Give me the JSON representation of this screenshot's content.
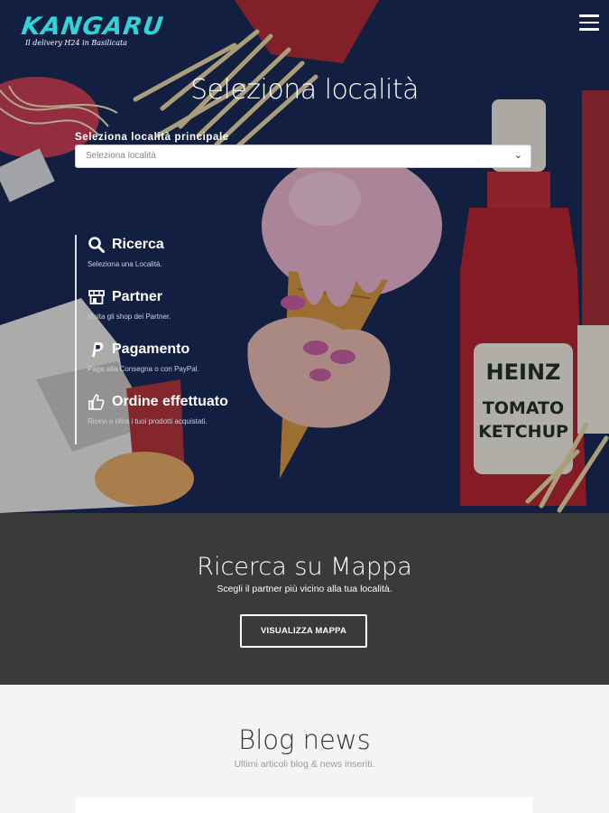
{
  "header": {
    "brand": "KANGARU",
    "tagline": "Il delivery H24 in Basilicata",
    "menu_icon": "hamburger-menu-icon"
  },
  "hero": {
    "title": "Seleziona località",
    "location_label": "Seleziona località principale",
    "location_placeholder": "Seleziona località",
    "steps": [
      {
        "icon": "search-icon",
        "title": "Ricerca",
        "desc": "Seleziona una Località."
      },
      {
        "icon": "shop-icon",
        "title": "Partner",
        "desc": "Visita gli shop dei Partner."
      },
      {
        "icon": "paypal-icon",
        "title": "Pagamento",
        "desc": "Paga alla Consegna o con PayPal."
      },
      {
        "icon": "thumbs-up-icon",
        "title": "Ordine effettuato",
        "desc": "Ricevi o ritira i tuoi prodotti acquistati."
      }
    ]
  },
  "map_section": {
    "title": "Ricerca su Mappa",
    "subtitle": "Scegli il partner più vicino alla tua località.",
    "button": "VISUALIZZA MAPPA"
  },
  "blog": {
    "title": "Blog news",
    "subtitle": "Ultimi articoli blog & news inseriti."
  },
  "colors": {
    "brand": "#2fd4d8",
    "hero_bg": "#14213f",
    "map_bg": "#3a3a3a",
    "blog_bg": "#f4f4f4"
  }
}
